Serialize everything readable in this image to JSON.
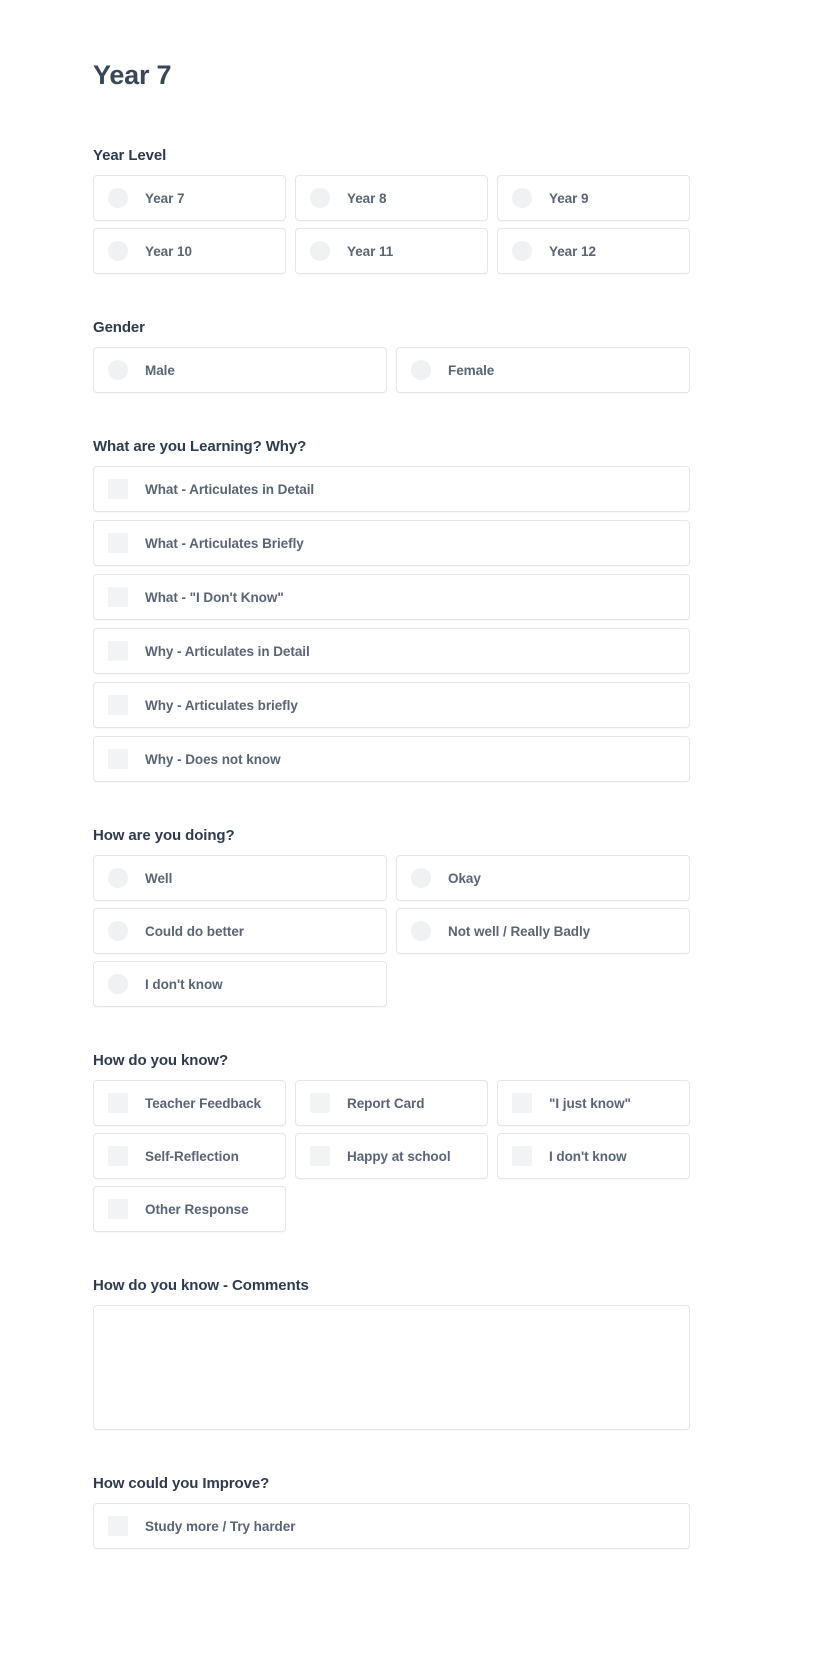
{
  "page": {
    "title": "Year 7"
  },
  "sections": [
    {
      "id": "year-level",
      "title": "Year Level",
      "control": "radio",
      "columns": 3,
      "options": [
        "Year 7",
        "Year 8",
        "Year 9",
        "Year 10",
        "Year 11",
        "Year 12"
      ]
    },
    {
      "id": "gender",
      "title": "Gender",
      "control": "radio",
      "columns": 2,
      "options": [
        "Male",
        "Female"
      ]
    },
    {
      "id": "what-are-you-learning-why",
      "title": "What are you Learning? Why?",
      "control": "checkbox",
      "columns": 1,
      "options": [
        "What - Articulates in Detail",
        "What - Articulates Briefly",
        "What - \"I Don't Know\"",
        "Why - Articulates in Detail",
        "Why - Articulates briefly",
        "Why - Does not know"
      ]
    },
    {
      "id": "how-are-you-doing",
      "title": "How are you doing?",
      "control": "radio",
      "columns": 2,
      "options": [
        "Well",
        "Okay",
        "Could do better",
        "Not well / Really Badly",
        "I don't know"
      ]
    },
    {
      "id": "how-do-you-know",
      "title": "How do you know?",
      "control": "checkbox",
      "columns": 3,
      "options": [
        "Teacher Feedback",
        "Report Card",
        "\"I just know\"",
        "Self-Reflection",
        "Happy at school",
        "I don't know",
        "Other Response"
      ]
    },
    {
      "id": "how-do-you-know-comments",
      "title": "How do you know - Comments",
      "control": "textarea",
      "value": "",
      "placeholder": ""
    },
    {
      "id": "how-could-you-improve",
      "title": "How could you Improve?",
      "control": "checkbox",
      "columns": 1,
      "options": [
        "Study more / Try harder"
      ]
    }
  ],
  "colors": {
    "page_background": "#ffffff",
    "title_text": "#39465a",
    "heading_text": "#2e3b4e",
    "label_text": "#5a6475",
    "card_border": "#e4e6e9",
    "control_fill": "#f0f1f3"
  }
}
